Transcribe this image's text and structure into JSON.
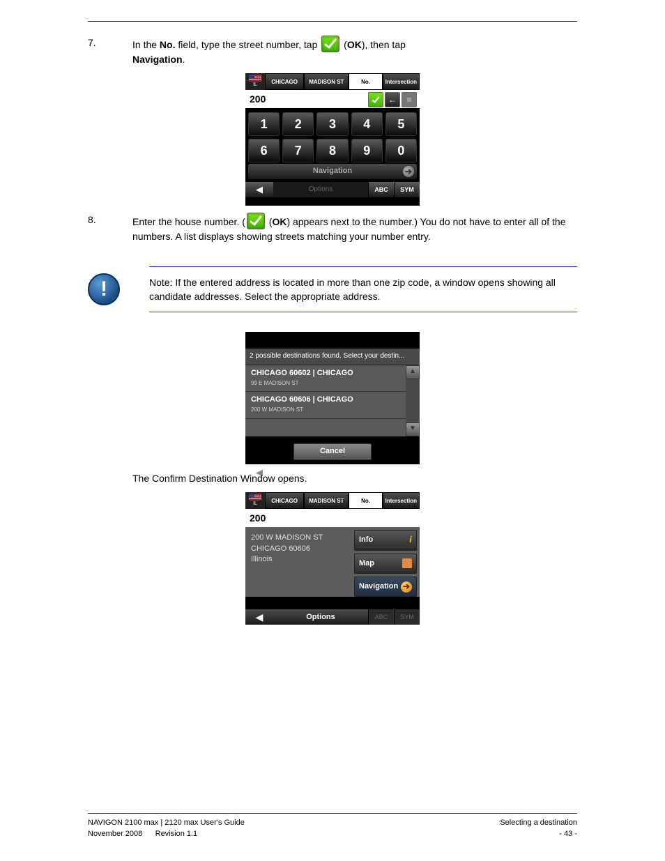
{
  "header_rule": true,
  "step7": {
    "num": "7.",
    "line1_a": "In the ",
    "line1_b": "No.",
    "line1_c": " field, type the street number, tap ",
    "line1_d": " (",
    "line1_e": "OK",
    "line1_f": "), then tap ",
    "line2_a": "Navigation",
    "line2_b": "."
  },
  "step8": {
    "num": "8.",
    "text_a": "Enter the house number. (",
    "text_b": " (",
    "text_c": "OK",
    "text_d": ") appears next to the number.) You do not have to enter all of the numbers. A list displays showing streets matching your number entry."
  },
  "note": {
    "text_a": "Note: If the entered address is located in more than one zip code, a window opens showing all candidate addresses. Select the appropriate address."
  },
  "para_confirm": "The Confirm Destination Window opens.",
  "shot1": {
    "flag_label": "IL",
    "tab_city": "CHICAGO",
    "tab_street": "MADISON  ST",
    "tab_no": "No.",
    "tab_inter": "Intersection",
    "input": "200",
    "keys": [
      "1",
      "2",
      "3",
      "4",
      "5",
      "6",
      "7",
      "8",
      "9",
      "0"
    ],
    "nav": "Navigation",
    "options": "Options",
    "abc": "ABC",
    "sym": "SYM"
  },
  "shot2": {
    "msg": "2 possible destinations found. Select your destin...",
    "items": [
      {
        "title": "CHICAGO 60602  | CHICAGO",
        "sub": "99 E MADISON ST"
      },
      {
        "title": "CHICAGO 60606  | CHICAGO",
        "sub": "200 W MADISON ST"
      }
    ],
    "cancel": "Cancel"
  },
  "shot3": {
    "flag_label": "IL",
    "tab_city": "CHICAGO",
    "tab_street": "MADISON  ST",
    "tab_no": "No.",
    "tab_inter": "Intersection",
    "input": "200",
    "addr_l1": "200 W MADISON ST",
    "addr_l2": "CHICAGO 60606",
    "addr_l3": "Illinois",
    "btn_info": "Info",
    "btn_map": "Map",
    "btn_nav": "Navigation",
    "options": "Options",
    "abc": "ABC",
    "sym": "SYM"
  },
  "footer": {
    "left": "NAVIGON 2100 max | 2120 max User's Guide",
    "right_a": "November 2008",
    "right_b": "Revision 1.1",
    "pagecol_a": "Selecting a destination",
    "pagecol_b": "- 43 -"
  }
}
